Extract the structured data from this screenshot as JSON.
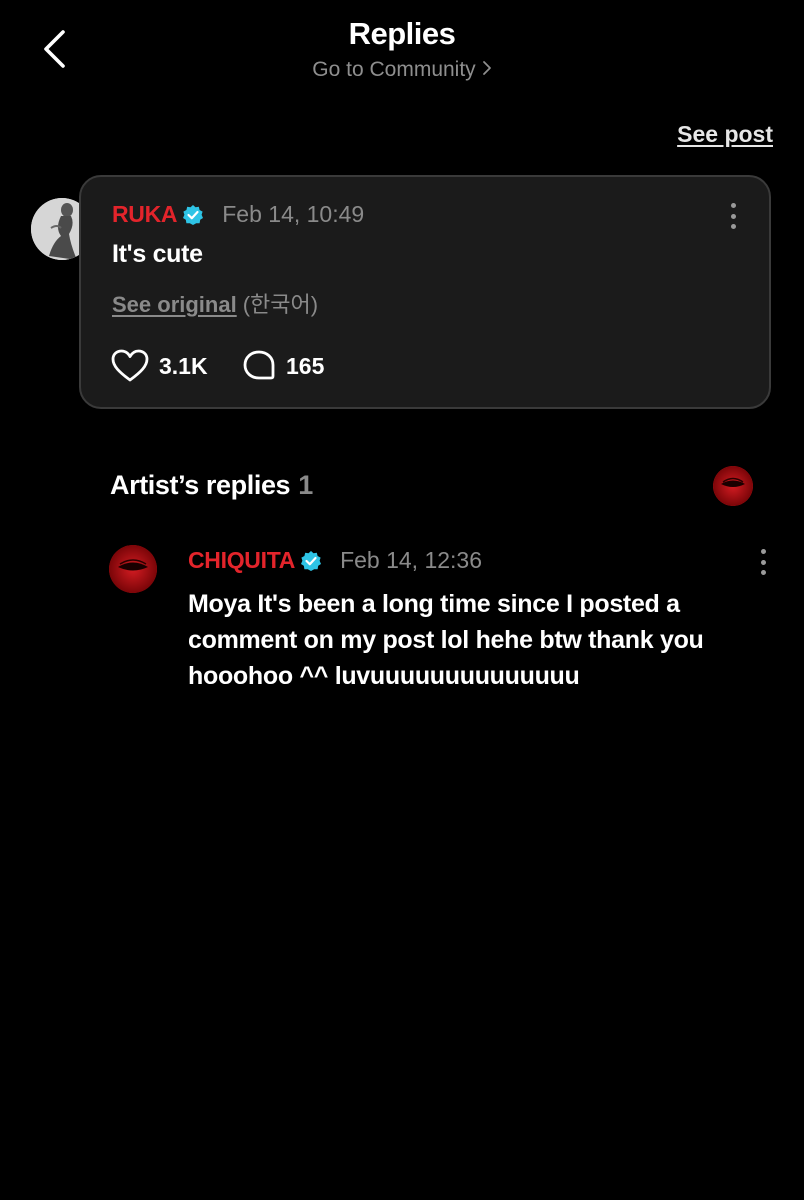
{
  "header": {
    "title": "Replies",
    "community_link": "Go to Community"
  },
  "see_post_label": "See post",
  "comment": {
    "author": "RUKA",
    "timestamp": "Feb 14, 10:49",
    "text": "It's cute",
    "see_original": "See original",
    "original_language": "(한국어)",
    "likes": "3.1K",
    "replies": "165"
  },
  "artist_replies": {
    "title": "Artist’s replies",
    "count": "1",
    "items": [
      {
        "author": "CHIQUITA",
        "timestamp": "Feb 14, 12:36",
        "text": "Moya It's been a long time since I posted a comment on my post lol hehe btw thank you hooohoo ^^ luvuuuuuuuuuuuuuu"
      }
    ]
  },
  "colors": {
    "background": "#000000",
    "card": "#1b1b1b",
    "author_red": "#e3242b",
    "verified_cyan": "#2ec4e6",
    "muted_text": "#8a8a8a"
  },
  "icons": [
    "back-icon",
    "chevron-right-icon",
    "verified-icon",
    "more-icon",
    "heart-icon",
    "comment-icon"
  ]
}
